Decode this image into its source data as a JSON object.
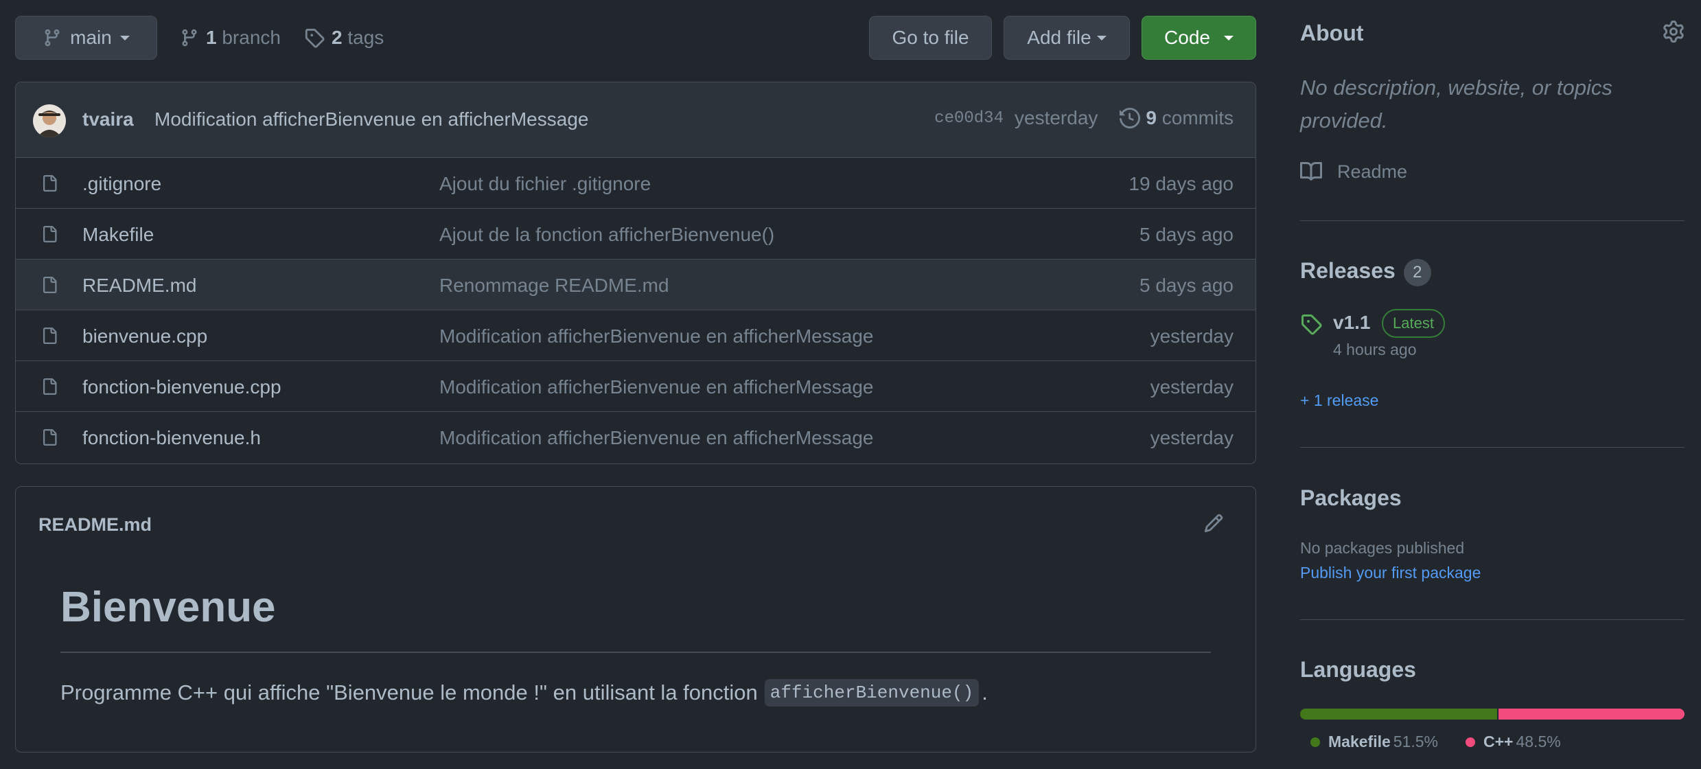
{
  "toolbar": {
    "branch_select": "main",
    "branches_count": "1",
    "branches_label": "branch",
    "tags_count": "2",
    "tags_label": "tags",
    "go_to_file": "Go to file",
    "add_file": "Add file",
    "code": "Code"
  },
  "commit": {
    "author": "tvaira",
    "message": "Modification afficherBienvenue en afficherMessage",
    "sha": "ce00d34",
    "time": "yesterday",
    "commits_count": "9",
    "commits_label": "commits"
  },
  "files": [
    {
      "name": ".gitignore",
      "message": "Ajout du fichier .gitignore",
      "date": "19 days ago"
    },
    {
      "name": "Makefile",
      "message": "Ajout de la fonction afficherBienvenue()",
      "date": "5 days ago"
    },
    {
      "name": "README.md",
      "message": "Renommage README.md",
      "date": "5 days ago"
    },
    {
      "name": "bienvenue.cpp",
      "message": "Modification afficherBienvenue en afficherMessage",
      "date": "yesterday"
    },
    {
      "name": "fonction-bienvenue.cpp",
      "message": "Modification afficherBienvenue en afficherMessage",
      "date": "yesterday"
    },
    {
      "name": "fonction-bienvenue.h",
      "message": "Modification afficherBienvenue en afficherMessage",
      "date": "yesterday"
    }
  ],
  "readme": {
    "file_title": "README.md",
    "heading": "Bienvenue",
    "paragraph": "Programme C++ qui affiche \"Bienvenue le monde !\" en utilisant la fonction",
    "code": "afficherBienvenue()",
    "paragraph_end": "."
  },
  "sidebar": {
    "about_title": "About",
    "about_desc": "No description, website, or topics provided.",
    "readme_link": "Readme",
    "releases_title": "Releases",
    "releases_count": "2",
    "release_name": "v1.1",
    "release_badge": "Latest",
    "release_date": "4 hours ago",
    "more_releases": "+ 1 release",
    "packages_title": "Packages",
    "packages_none": "No packages published",
    "packages_link": "Publish your first package",
    "languages_title": "Languages",
    "languages": [
      {
        "name": "Makefile",
        "percent": "51.5%",
        "value": 51.5,
        "color": "#427819"
      },
      {
        "name": "C++",
        "percent": "48.5%",
        "value": 48.5,
        "color": "#f34b7d"
      }
    ]
  },
  "colors": {
    "background": "#22272e",
    "accent_green": "#347d39",
    "link_blue": "#539bf5"
  }
}
